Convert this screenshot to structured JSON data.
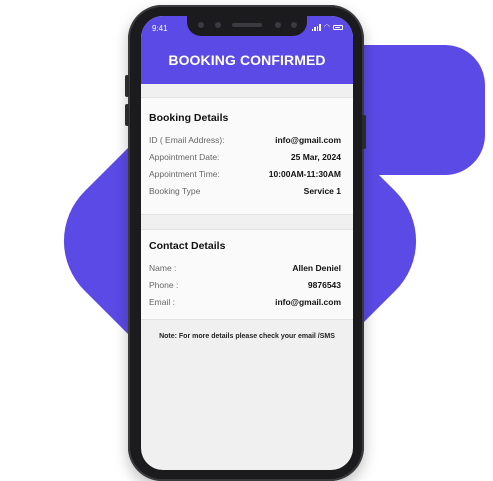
{
  "status_bar": {
    "time": "9:41"
  },
  "header": {
    "title": "BOOKING CONFIRMED"
  },
  "booking": {
    "heading": "Booking Details",
    "rows": [
      {
        "label": "ID ( Email Address):",
        "value": "info@gmail.com"
      },
      {
        "label": "Appointment Date:",
        "value": "25 Mar, 2024"
      },
      {
        "label": "Appointment Time:",
        "value": "10:00AM-11:30AM"
      },
      {
        "label": "Booking Type",
        "value": "Service 1"
      }
    ]
  },
  "contact": {
    "heading": "Contact Details",
    "rows": [
      {
        "label": "Name :",
        "value": "Allen Deniel"
      },
      {
        "label": "Phone :",
        "value": "9876543"
      },
      {
        "label": "Email :",
        "value": "info@gmail.com"
      }
    ]
  },
  "note": "Note: For more details please check your email /SMS",
  "colors": {
    "accent": "#5b4ae6",
    "phone_frame": "#1b1b1d",
    "screen_bg": "#f0f0f0"
  }
}
